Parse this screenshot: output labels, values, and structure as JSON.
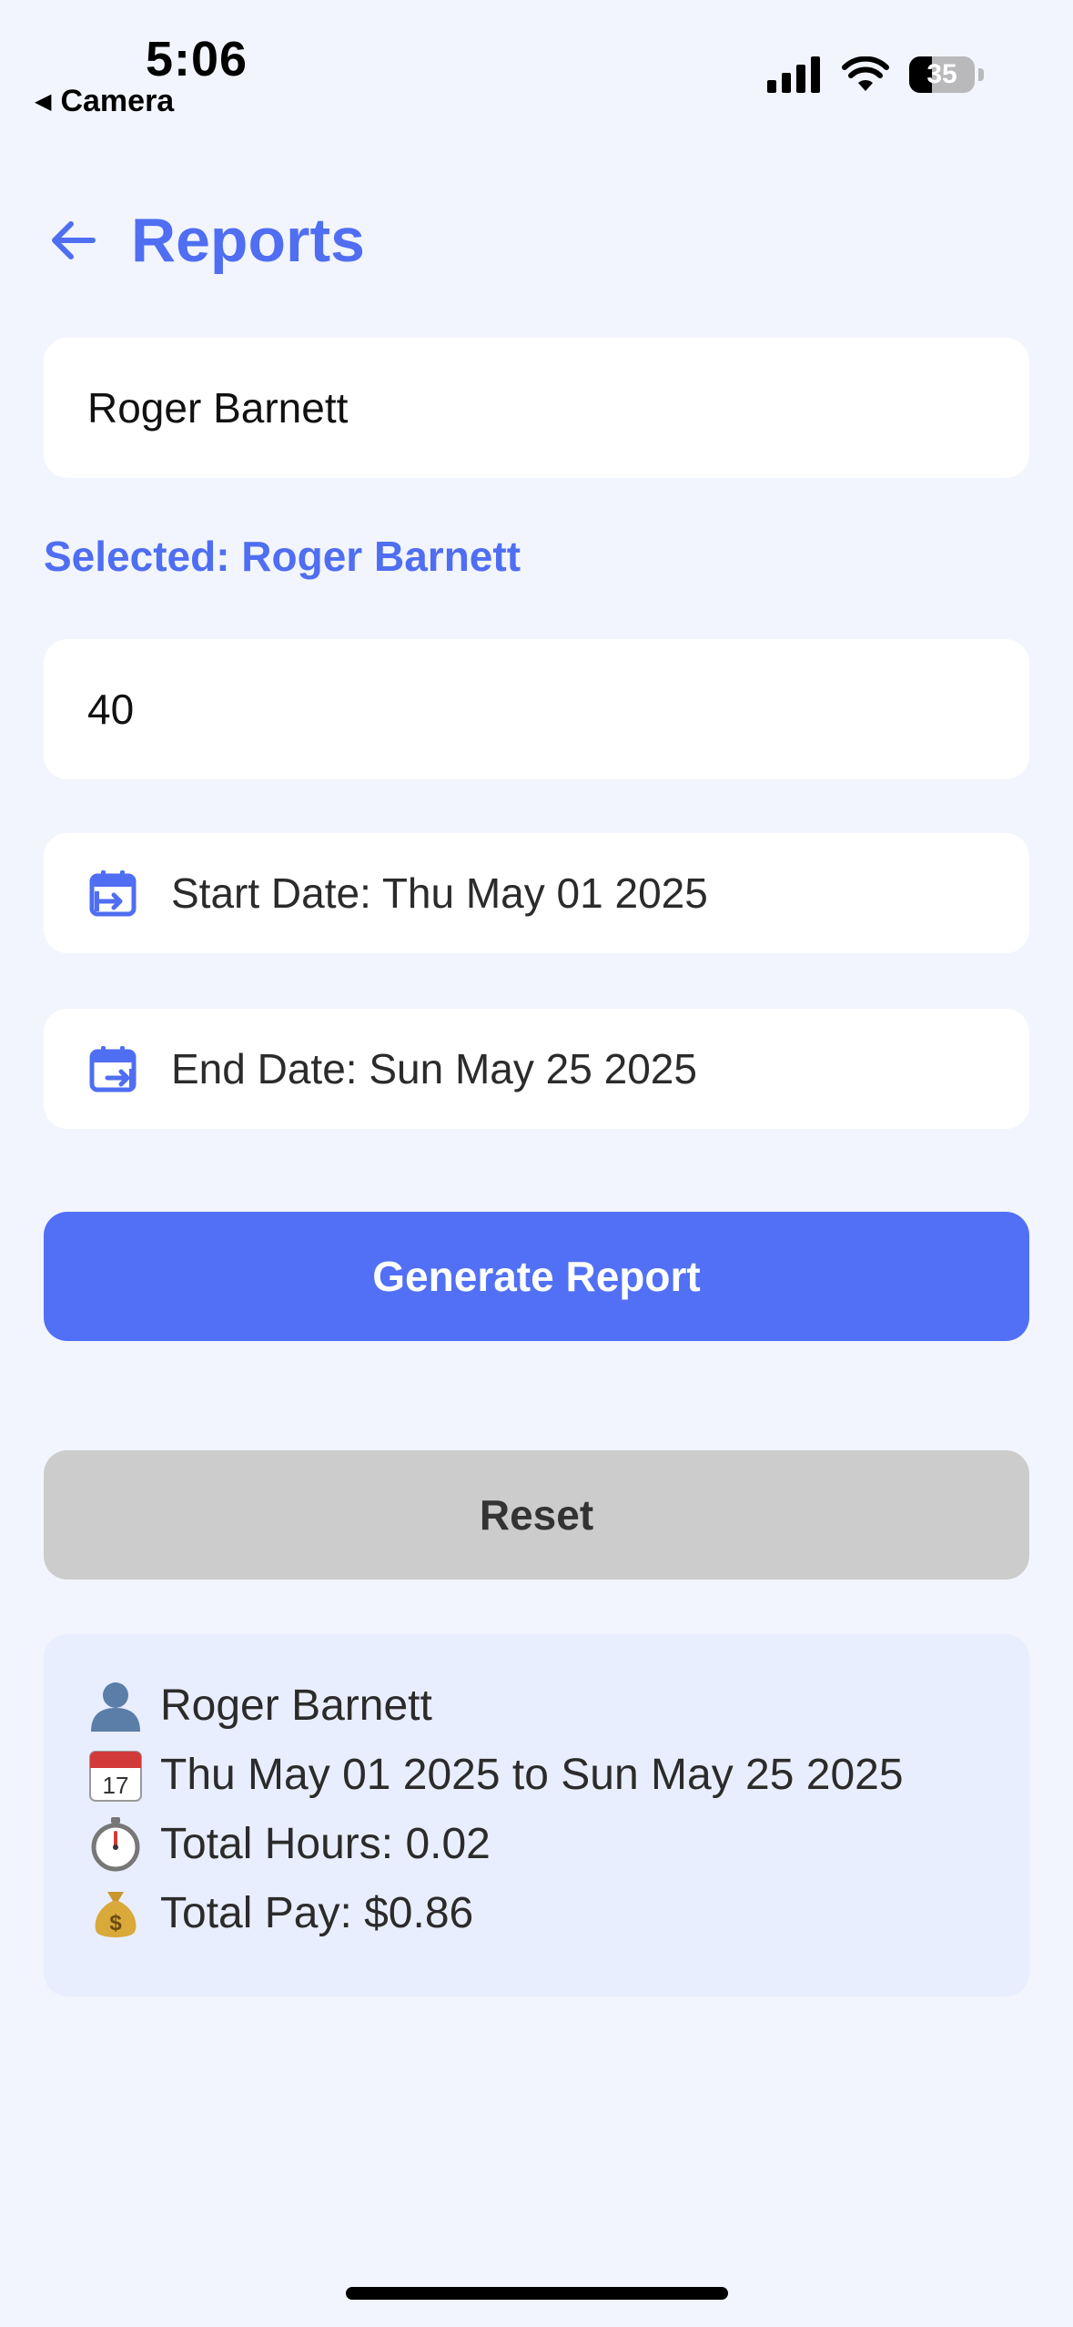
{
  "status_bar": {
    "time": "5:06",
    "back_label": "Camera",
    "battery": "35",
    "battery_level": 0.35
  },
  "header": {
    "title": "Reports"
  },
  "form": {
    "employee_value": "Roger Barnett",
    "selected_text": "Selected: Roger Barnett",
    "rate_value": "40",
    "start_date_text": "Start Date: Thu May 01 2025",
    "end_date_text": "End Date: Sun May 25 2025",
    "generate_label": "Generate Report",
    "reset_label": "Reset"
  },
  "report": {
    "name": "Roger Barnett",
    "date_range": "Thu May 01 2025 to Sun May 25 2025",
    "total_hours": "Total Hours: 0.02",
    "total_pay": "Total Pay: $0.86",
    "icons": [
      "person-icon",
      "calendar-icon",
      "stopwatch-icon",
      "money-bag-icon"
    ]
  },
  "colors": {
    "accent": "#4f6ef2",
    "primary_button": "#5170f5",
    "secondary_button": "#cccccc",
    "background": "#f2f5fd",
    "card_background": "#e8eefd"
  }
}
